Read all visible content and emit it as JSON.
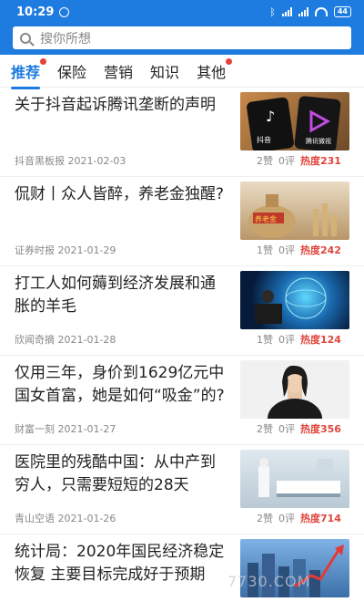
{
  "statusbar": {
    "time": "10:29",
    "battery": "44"
  },
  "search": {
    "placeholder": "搜你所想"
  },
  "tabs": [
    {
      "label": "推荐",
      "active": true,
      "dot": true
    },
    {
      "label": "保险",
      "active": false,
      "dot": false
    },
    {
      "label": "营销",
      "active": false,
      "dot": false
    },
    {
      "label": "知识",
      "active": false,
      "dot": false
    },
    {
      "label": "其他",
      "active": false,
      "dot": true
    }
  ],
  "articles": [
    {
      "title": "关于抖音起诉腾讯垄断的声明",
      "source": "抖音黑板报",
      "date": "2021-02-03",
      "likes": "2赞",
      "comments": "0评",
      "heat": "热度231",
      "thumb_text_1": "抖音",
      "thumb_text_2": "腾讯微视"
    },
    {
      "title": "侃财丨众人皆醉，养老金独醒?",
      "source": "证券时报",
      "date": "2021-01-29",
      "likes": "1赞",
      "comments": "0评",
      "heat": "热度242",
      "thumb_text_1": "养老金"
    },
    {
      "title": "打工人如何薅到经济发展和通胀的羊毛",
      "source": "欣闻奇摘",
      "date": "2021-01-28",
      "likes": "1赞",
      "comments": "0评",
      "heat": "热度124"
    },
    {
      "title": "仅用三年，身价到1629亿元中国女首富，她是如何“吸金”的?",
      "source": "财富一刻",
      "date": "2021-01-27",
      "likes": "2赞",
      "comments": "0评",
      "heat": "热度356"
    },
    {
      "title": "医院里的残酷中国：从中产到穷人，只需要短短的28天",
      "source": "青山空语",
      "date": "2021-01-26",
      "likes": "2赞",
      "comments": "0评",
      "heat": "热度714"
    },
    {
      "title": "统计局：2020年国民经济稳定恢复 主要目标完成好于预期",
      "source": "",
      "date": "",
      "likes": "",
      "comments": "",
      "heat": ""
    }
  ],
  "watermark": "7730.COM"
}
